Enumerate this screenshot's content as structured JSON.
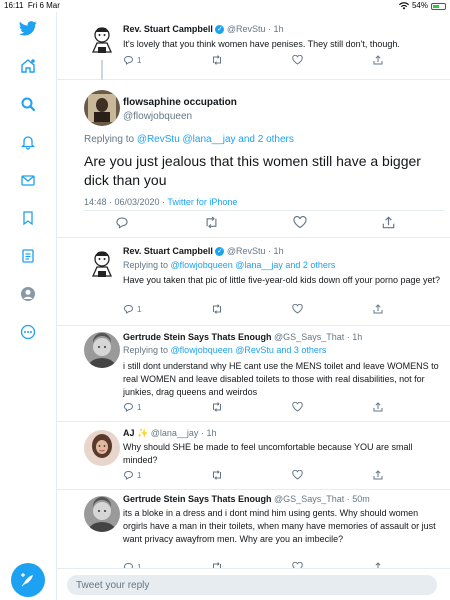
{
  "status_bar": {
    "time": "16:11",
    "date": "Fri 6 Mar",
    "battery": "54%"
  },
  "nav": {
    "items": [
      "twitter-logo",
      "home",
      "search",
      "notifications",
      "messages",
      "bookmarks",
      "lists",
      "profile",
      "more"
    ],
    "accent": "#1da1f2"
  },
  "tweets": [
    {
      "name": "Rev. Stuart Campbell",
      "verified": true,
      "handle": "@RevStu",
      "time": "· 1h",
      "text": "It's lovely that you think women have penises. They still don't, though.",
      "reply_count": "1"
    },
    {
      "name": "flowsaphine occupation",
      "handle": "@flowjobqueen",
      "replying_prefix": "Replying to",
      "replying_to": "@RevStu @lana__jay and 2 others",
      "text": "Are you just jealous that this women still have a bigger dick than you",
      "timestamp": "14:48 · 06/03/2020 · ",
      "client": "Twitter for iPhone"
    },
    {
      "name": "Rev. Stuart Campbell",
      "verified": true,
      "handle": "@RevStu",
      "time": "· 1h",
      "replying_prefix": "Replying to",
      "replying_to": "@flowjobqueen @lana__jay and 2 others",
      "text": "Have you taken that pic of little five-year-old kids down off your porno page yet?",
      "reply_count": "1"
    },
    {
      "name": "Gertrude Stein Says Thats Enough",
      "handle": "@GS_Says_That",
      "time": "· 1h",
      "replying_prefix": "Replying to",
      "replying_to": "@flowjobqueen @RevStu and 3 others",
      "text": "i still dont understand why HE cant use the MENS toilet and leave WOMENS to real WOMEN  and leave disabled toilets to those with real disabilities, not for junkies, drag queens and weirdos",
      "reply_count": "1"
    },
    {
      "name": "AJ",
      "sparkle": "✨",
      "handle": "@lana__jay",
      "time": "· 1h",
      "text": "Why should SHE be made to feel uncomfortable because YOU are small minded?",
      "reply_count": "1"
    },
    {
      "name": "Gertrude Stein Says Thats Enough",
      "handle": "@GS_Says_That",
      "time": "· 50m",
      "text": "its a bloke in a dress and i dont mind him using gents. Why should women orgirls have a man in their toilets, when many have memories of assault or just want privacy awayfrom men. Why are you an imbecile?",
      "reply_count": "1"
    }
  ],
  "reply_box": {
    "placeholder": "Tweet your reply"
  }
}
